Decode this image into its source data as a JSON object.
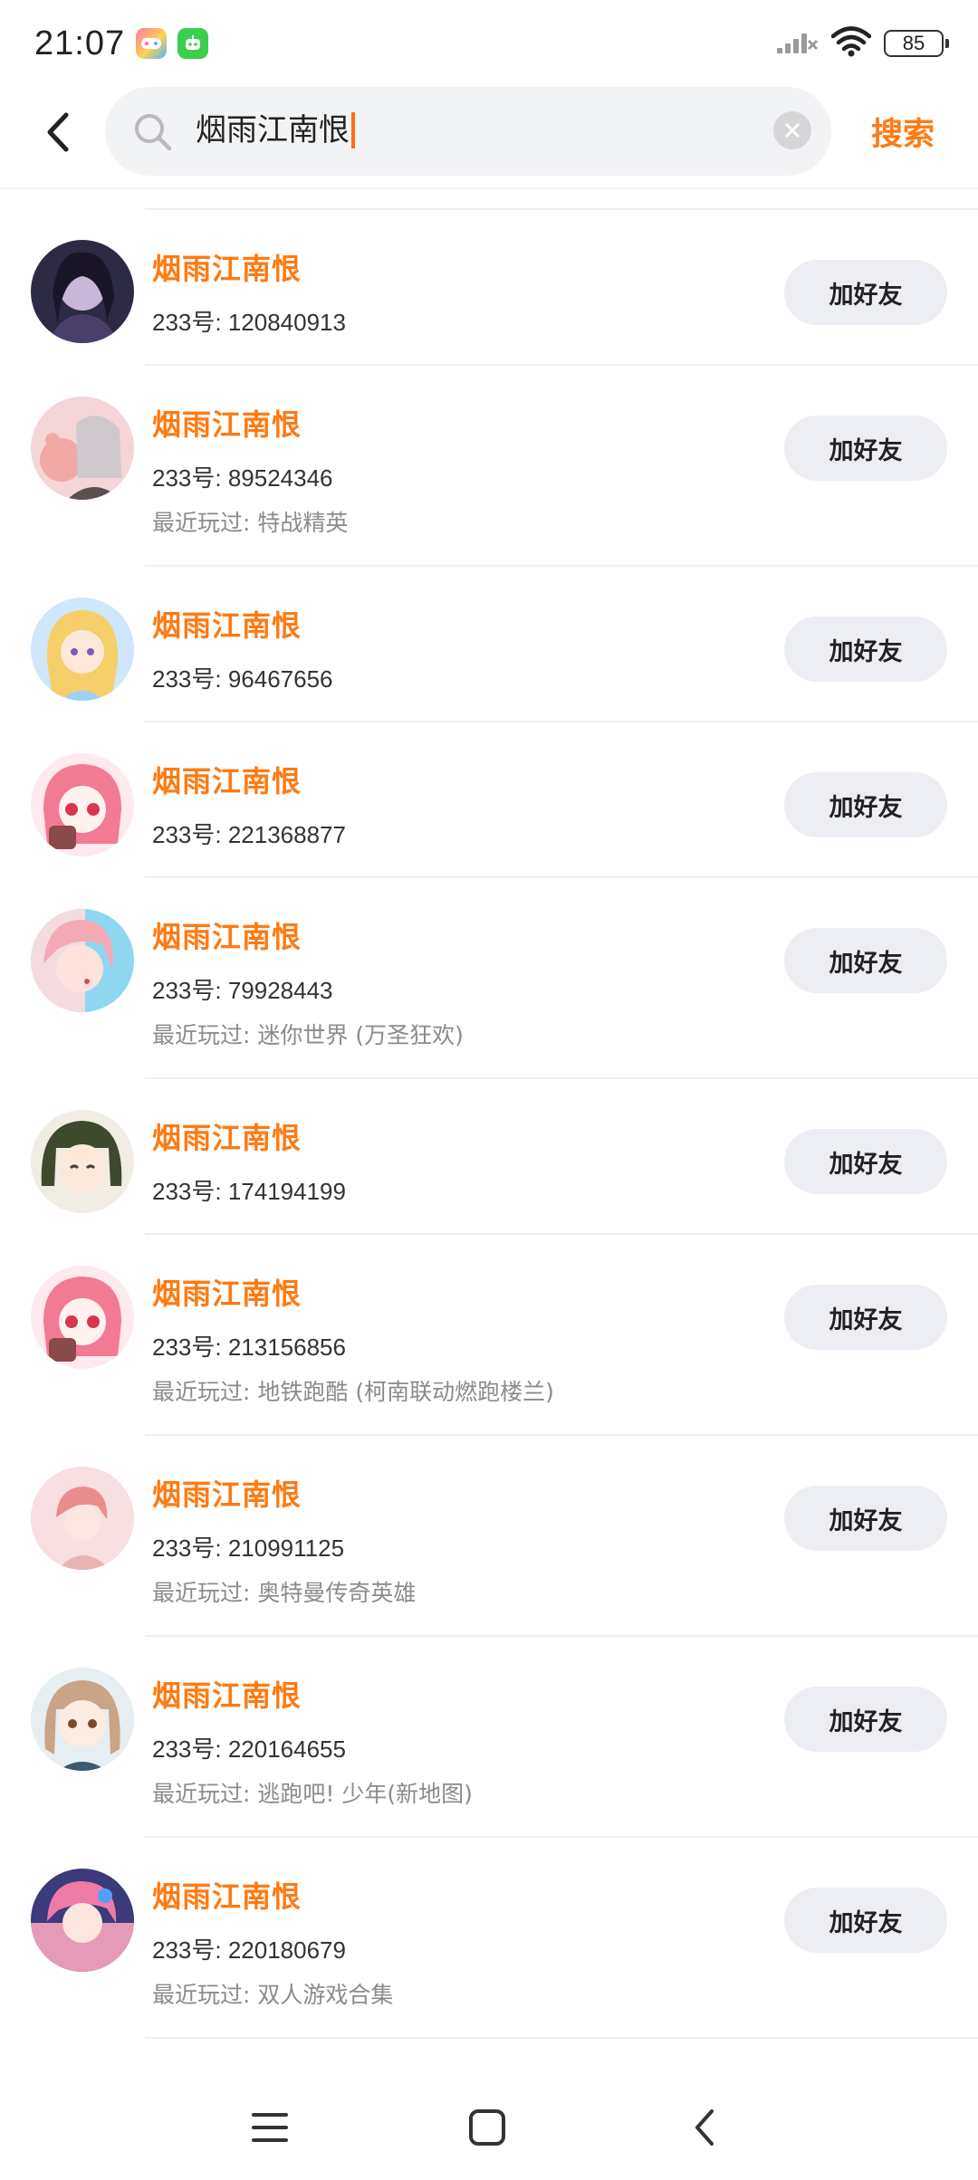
{
  "status_bar": {
    "time": "21:07",
    "battery": "85"
  },
  "search": {
    "query": "烟雨江南恨",
    "submit_label": "搜索"
  },
  "results": [
    {
      "name": "烟雨江南恨",
      "uid": "233号: 120840913",
      "recent": ""
    },
    {
      "name": "烟雨江南恨",
      "uid": "233号: 89524346",
      "recent": "最近玩过: 特战精英"
    },
    {
      "name": "烟雨江南恨",
      "uid": "233号: 96467656",
      "recent": ""
    },
    {
      "name": "烟雨江南恨",
      "uid": "233号: 221368877",
      "recent": ""
    },
    {
      "name": "烟雨江南恨",
      "uid": "233号: 79928443",
      "recent": "最近玩过: 迷你世界 (万圣狂欢)"
    },
    {
      "name": "烟雨江南恨",
      "uid": "233号: 174194199",
      "recent": ""
    },
    {
      "name": "烟雨江南恨",
      "uid": "233号: 213156856",
      "recent": "最近玩过: 地铁跑酷 (柯南联动燃跑楼兰)"
    },
    {
      "name": "烟雨江南恨",
      "uid": "233号: 210991125",
      "recent": "最近玩过: 奥特曼传奇英雄"
    },
    {
      "name": "烟雨江南恨",
      "uid": "233号: 220164655",
      "recent": "最近玩过: 逃跑吧! 少年(新地图)"
    },
    {
      "name": "烟雨江南恨",
      "uid": "233号: 220180679",
      "recent": "最近玩过: 双人游戏合集"
    }
  ],
  "add_friend_label": "加好友",
  "colors": {
    "accent": "#ff7a12",
    "button_bg": "#eceef3",
    "secondary_text": "#8b8b8b"
  },
  "icons": [
    "back-arrow-icon",
    "search-icon",
    "clear-icon",
    "menu-icon",
    "home-icon",
    "nav-back-icon",
    "signal-icon",
    "wifi-icon",
    "battery-icon"
  ]
}
